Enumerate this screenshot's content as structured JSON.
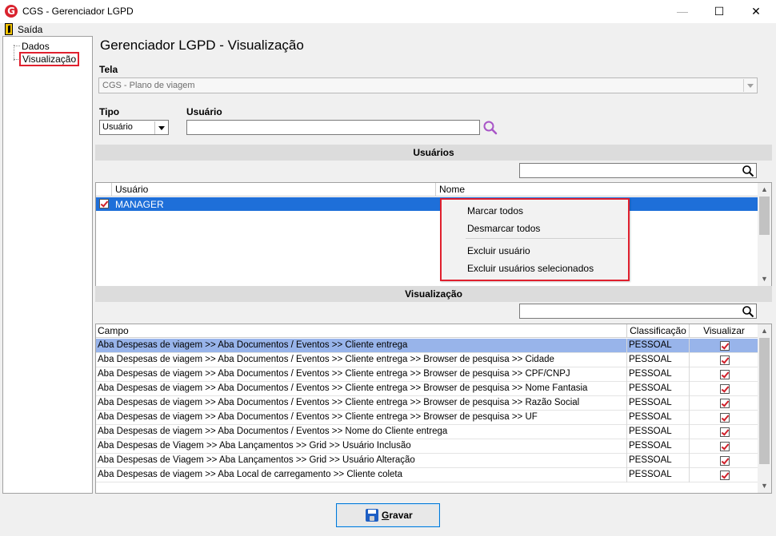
{
  "window": {
    "title": "CGS - Gerenciador LGPD",
    "minimize": "—",
    "maximize": "☐",
    "close": "✕"
  },
  "menu": {
    "exit": "Saída"
  },
  "tree": {
    "items": [
      "Dados",
      "Visualização"
    ],
    "selected": "Visualização"
  },
  "page": {
    "title": "Gerenciador LGPD - Visualização"
  },
  "tela": {
    "label": "Tela",
    "value": "CGS - Plano de viagem"
  },
  "tipo": {
    "label": "Tipo",
    "value": "Usuário"
  },
  "usuario": {
    "label": "Usuário",
    "value": ""
  },
  "users_section": {
    "title": "Usuários",
    "columns": [
      "Usuário",
      "Nome"
    ],
    "rows": [
      {
        "checked": true,
        "user": "MANAGER",
        "name": ""
      }
    ]
  },
  "context_menu": {
    "items": [
      "Marcar todos",
      "Desmarcar todos",
      "Excluir usuário",
      "Excluir usuários selecionados"
    ]
  },
  "view_section": {
    "title": "Visualização",
    "columns": [
      "Campo",
      "Classificação",
      "Visualizar"
    ],
    "rows": [
      {
        "campo": "Aba Despesas de viagem >> Aba Documentos  / Eventos >> Cliente entrega",
        "classificacao": "PESSOAL",
        "visualizar": true
      },
      {
        "campo": "Aba Despesas de viagem >> Aba Documentos  / Eventos >> Cliente entrega >> Browser de pesquisa >> Cidade",
        "classificacao": "PESSOAL",
        "visualizar": true
      },
      {
        "campo": "Aba Despesas de viagem >> Aba Documentos  / Eventos >> Cliente entrega >> Browser de pesquisa >> CPF/CNPJ",
        "classificacao": "PESSOAL",
        "visualizar": true
      },
      {
        "campo": "Aba Despesas de viagem >> Aba Documentos  / Eventos >> Cliente entrega >> Browser de pesquisa >> Nome Fantasia",
        "classificacao": "PESSOAL",
        "visualizar": true
      },
      {
        "campo": "Aba Despesas de viagem >> Aba Documentos  / Eventos >> Cliente entrega >> Browser de pesquisa >> Razão Social",
        "classificacao": "PESSOAL",
        "visualizar": true
      },
      {
        "campo": "Aba Despesas de viagem >> Aba Documentos  / Eventos >> Cliente entrega >> Browser de pesquisa >> UF",
        "classificacao": "PESSOAL",
        "visualizar": true
      },
      {
        "campo": "Aba Despesas de viagem >> Aba Documentos  / Eventos >> Nome do Cliente entrega",
        "classificacao": "PESSOAL",
        "visualizar": true
      },
      {
        "campo": "Aba Despesas de Viagem >> Aba Lançamentos >>  Grid >> Usuário Inclusão",
        "classificacao": "PESSOAL",
        "visualizar": true
      },
      {
        "campo": "Aba Despesas de Viagem >> Aba Lançamentos >> Grid >> Usuário Alteração",
        "classificacao": "PESSOAL",
        "visualizar": true
      },
      {
        "campo": "Aba Despesas de viagem >> Aba Local de carregamento >> Cliente coleta",
        "classificacao": "PESSOAL",
        "visualizar": true
      }
    ]
  },
  "save": {
    "label_underlined": "G",
    "label_rest": "ravar"
  },
  "colors": {
    "accent": "#1e6fd9",
    "highlight_border": "#e0202e",
    "selected_row": "#98b4ea"
  }
}
